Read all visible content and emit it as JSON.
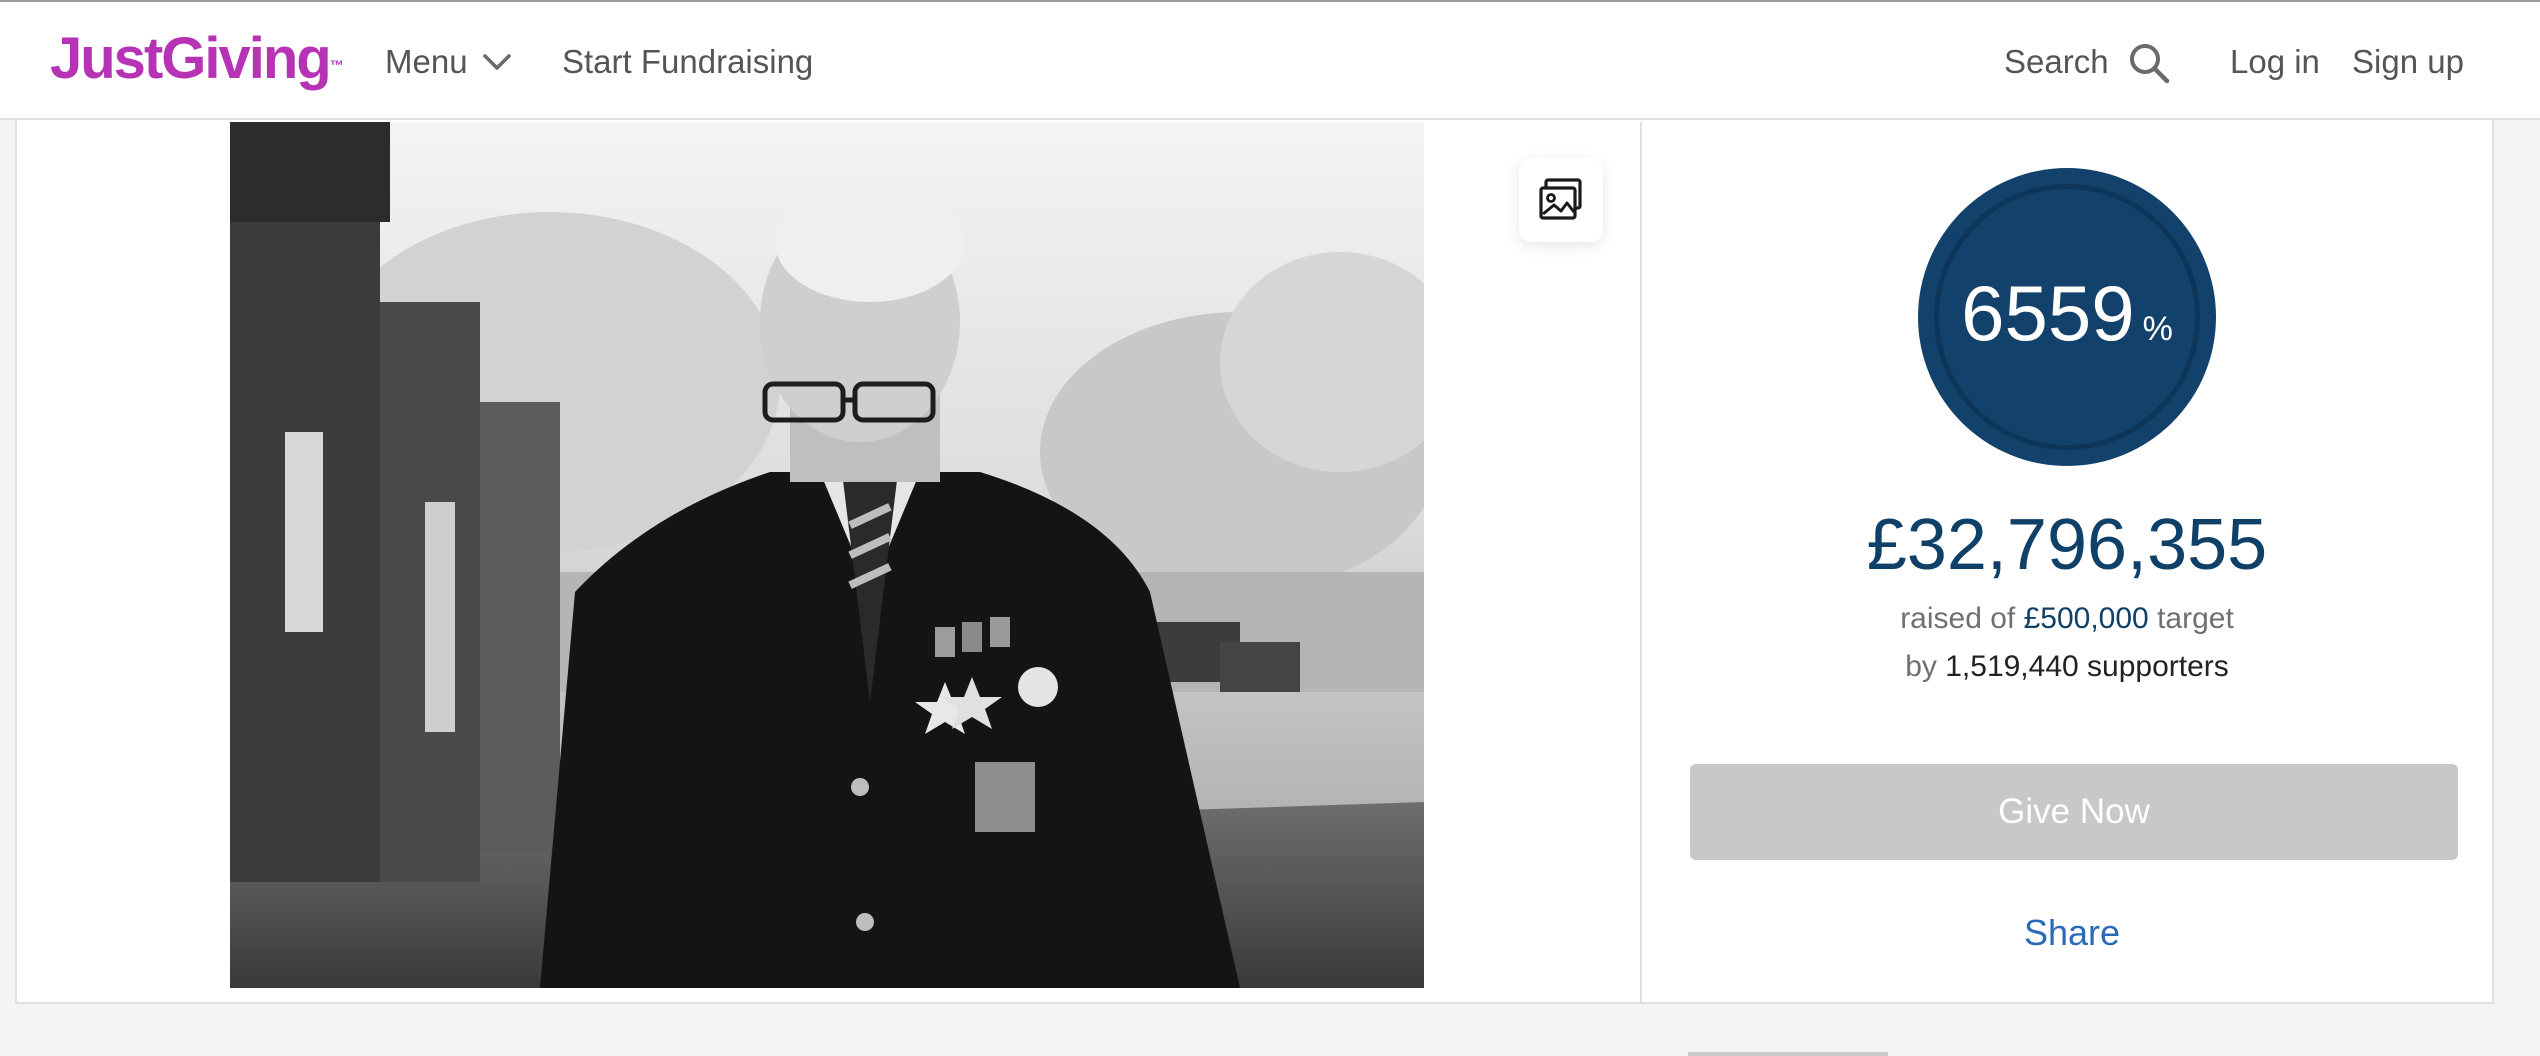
{
  "header": {
    "logo": "JustGiving",
    "logo_tm": "™",
    "menu_label": "Menu",
    "start_fundraising": "Start Fundraising",
    "search_label": "Search",
    "login": "Log in",
    "signup": "Sign up"
  },
  "colors": {
    "brand": "#b633b6",
    "navy": "#12426b",
    "link": "#2a6ab8",
    "button_disabled": "#c8c8c8"
  },
  "campaign": {
    "percent": "6559",
    "percent_symbol": "%",
    "progress_fraction": 65.59,
    "raised": "£32,796,355",
    "raised_prefix": "raised of",
    "target": "£500,000",
    "target_suffix": "target",
    "supporters_prefix": "by",
    "supporters": "1,519,440 supporters",
    "give_now": "Give Now",
    "share": "Share"
  },
  "icons": {
    "menu_chevron": "chevron-down-icon",
    "search": "search-icon",
    "gallery": "gallery-icon"
  }
}
